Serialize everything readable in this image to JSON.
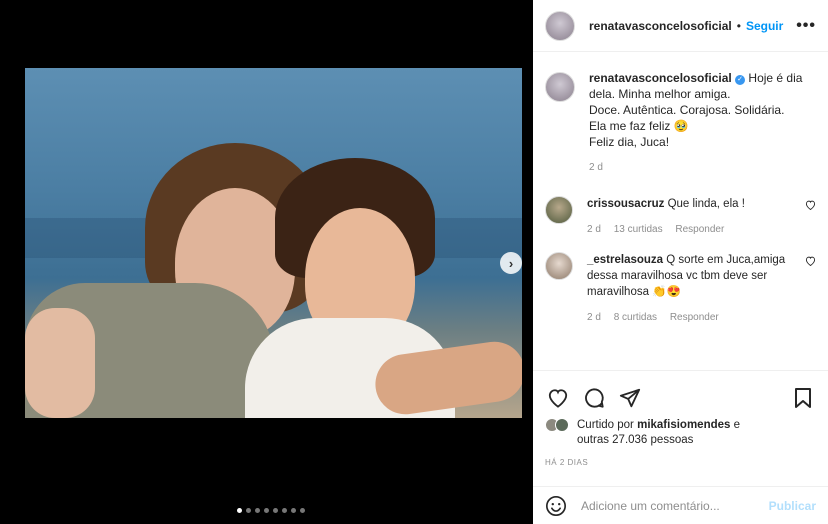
{
  "post": {
    "username": "renatavasconcelosoficial",
    "separator": "•",
    "follow_label": "Seguir",
    "more_label": "•••"
  },
  "caption": {
    "username": "renatavasconcelosoficial",
    "text_line1": " Hoje é dia",
    "text_line2": "dela. Minha melhor amiga.",
    "text_line3": "Doce. Autêntica. Corajosa. Solidária.",
    "text_line4": "Ela me faz feliz 🥹",
    "text_line5": "Feliz dia, Juca!",
    "time": "2 d"
  },
  "comments": [
    {
      "username": "crissousacruz",
      "text": "Que linda, ela !",
      "time": "2 d",
      "likes": "13 curtidas",
      "reply": "Responder"
    },
    {
      "username": "_estrelasouza",
      "text": "Q sorte em Juca,amiga dessa maravilhosa vc tbm deve ser maravilhosa 👏😍",
      "time": "2 d",
      "likes": "8 curtidas",
      "reply": "Responder"
    }
  ],
  "likes": {
    "prefix": "Curtido por",
    "user": "mikafisiomendes",
    "suffix": "e",
    "others": "outras 27.036 pessoas"
  },
  "posted_time": "HÁ 2 DIAS",
  "composer": {
    "placeholder": "Adicione um comentário...",
    "publish_label": "Publicar"
  },
  "carousel": {
    "next_label": "›",
    "dots_count": 8,
    "active_index": 0
  },
  "colors": {
    "accent": "#0095f6",
    "verified": "#3897f0",
    "publish_disabled": "#b2dffc"
  }
}
